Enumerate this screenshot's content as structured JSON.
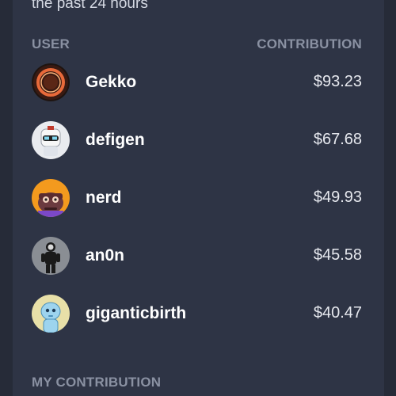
{
  "subtitle": "the past 24 hours",
  "table": {
    "header_user": "USER",
    "header_contribution": "CONTRIBUTION"
  },
  "rows": [
    {
      "name": "Gekko",
      "amount": "$93.23",
      "avatar": "gekko-avatar"
    },
    {
      "name": "defigen",
      "amount": "$67.68",
      "avatar": "defigen-avatar"
    },
    {
      "name": "nerd",
      "amount": "$49.93",
      "avatar": "nerd-avatar"
    },
    {
      "name": "an0n",
      "amount": "$45.58",
      "avatar": "an0n-avatar"
    },
    {
      "name": "giganticbirth",
      "amount": "$40.47",
      "avatar": "giganticbirth-avatar"
    }
  ],
  "my_contribution_label": "MY CONTRIBUTION"
}
